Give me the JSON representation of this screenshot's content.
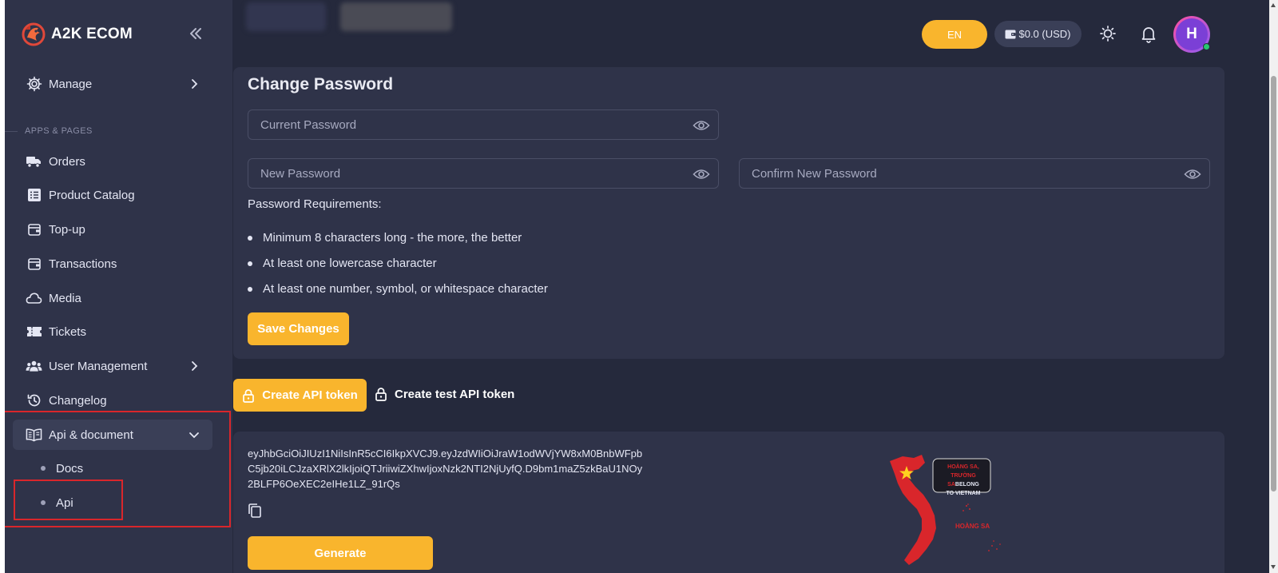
{
  "brand": {
    "name": "A2K ECOM"
  },
  "sidebar": {
    "manage": {
      "label": "Manage",
      "icon": "gear-icon"
    },
    "section_label": "APPS & PAGES",
    "items": [
      {
        "label": "Orders",
        "icon": "truck-icon"
      },
      {
        "label": "Product Catalog",
        "icon": "list-icon"
      },
      {
        "label": "Top-up",
        "icon": "wallet-icon"
      },
      {
        "label": "Transactions",
        "icon": "wallet-icon"
      },
      {
        "label": "Media",
        "icon": "cloud-icon"
      },
      {
        "label": "Tickets",
        "icon": "ticket-icon"
      },
      {
        "label": "User Management",
        "icon": "users-icon"
      },
      {
        "label": "Changelog",
        "icon": "history-icon"
      },
      {
        "label": "Api & document",
        "icon": "book-icon"
      }
    ],
    "sub_items": [
      {
        "label": "Docs"
      },
      {
        "label": "Api"
      }
    ]
  },
  "header": {
    "language": "EN",
    "balance": "$0.0 (USD)",
    "avatar_initial": "H"
  },
  "change_password": {
    "title": "Change Password",
    "current_placeholder": "Current Password",
    "new_placeholder": "New Password",
    "confirm_placeholder": "Confirm New Password",
    "requirements_title": "Password Requirements:",
    "requirements": [
      "Minimum 8 characters long - the more, the better",
      "At least one lowercase character",
      "At least one number, symbol, or whitespace character"
    ],
    "save_label": "Save Changes"
  },
  "api_tabs": {
    "create_label": "Create API token",
    "create_test_label": "Create test API token"
  },
  "api_token": {
    "token": "eyJhbGciOiJIUzI1NiIsInR5cCI6IkpXVCJ9.eyJzdWIiOiJraW1odWVjYW8xM0BnbWFpbC5jb20iLCJzaXRlX2lkIjoiQTJriiwiZXhwIjoxNzk2NTI2NjUyfQ.D9bm1maZ5zkBaU1NOy2BLFP6OeXEC2eIHe1LZ_91rQs",
    "generate_label": "Generate"
  },
  "map_badge": {
    "line1": "HOÀNG SA,",
    "line2": "TRƯỜNG SA",
    "line2b": "BELONG",
    "line3": "TO VIETNAM",
    "island_label": "HOÀNG SA"
  },
  "colors": {
    "accent": "#f9b52d",
    "sidebar_bg": "#2f3349",
    "page_bg": "#25293c",
    "highlight": "#d9262b"
  }
}
